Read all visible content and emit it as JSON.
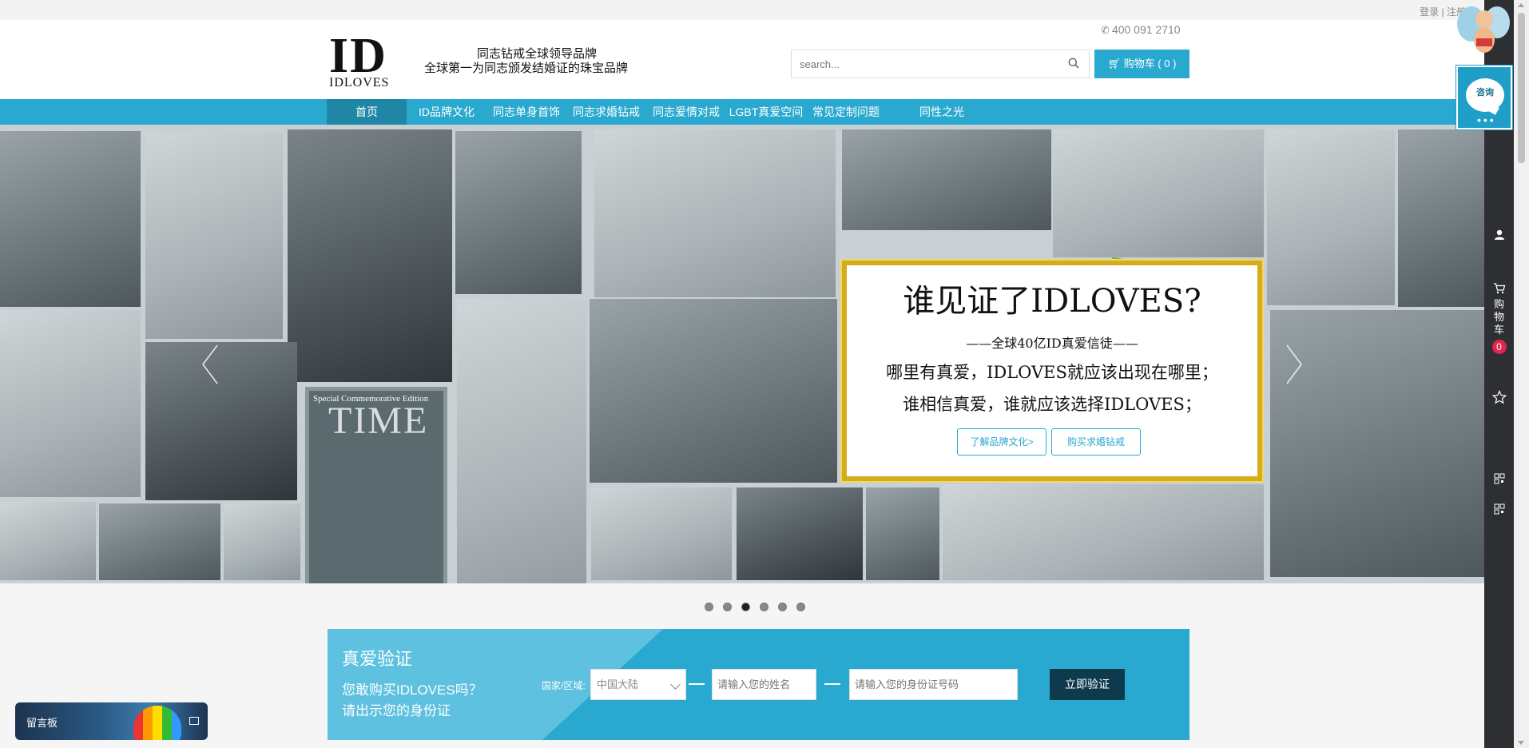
{
  "topbar": {
    "login": "登录",
    "separator": "|",
    "register": "注册"
  },
  "header": {
    "logo_mark": "ID",
    "logo_word": "IDLOVES",
    "slogan_line1": "同志钻戒全球领导品牌",
    "slogan_line2": "全球第一为同志颁发结婚证的珠宝品牌",
    "phone": "400 091 2710",
    "search_placeholder": "search...",
    "cart_label": "购物车 ( 0 )"
  },
  "nav": {
    "items": [
      {
        "label": "首页",
        "active": true
      },
      {
        "label": "ID品牌文化"
      },
      {
        "label": "同志单身首饰"
      },
      {
        "label": "同志求婚钻戒"
      },
      {
        "label": "同志爱情对戒"
      },
      {
        "label": "LGBT真爱空间"
      },
      {
        "label": "常见定制问题"
      },
      {
        "label": "同性之光"
      }
    ]
  },
  "banner": {
    "time_cover_label": "Special Commemorative Edition",
    "time_cover_title": "TIME",
    "title": "谁见证了IDLOVES?",
    "subtitle": "——全球40亿ID真爱信徒——",
    "line1": "哪里有真爱，IDLOVES就应该出现在哪里；",
    "line2": "谁相信真爱，谁就应该选择IDLOVES；",
    "btn_culture": "了解品牌文化>",
    "btn_buy": "购买求婚钻戒",
    "slides": 6,
    "active_slide": 3
  },
  "verify": {
    "title": "真爱验证",
    "desc_line1": "您敢购买IDLOVES吗？",
    "desc_line2": "请出示您的身份证",
    "region_label": "国家/区域:",
    "region_value": "中国大陆",
    "name_placeholder": "请输入您的姓名",
    "id_placeholder": "请输入您的身份证号码",
    "submit_label": "立即验证"
  },
  "sidebar": {
    "cart_chars": [
      "购",
      "物",
      "车"
    ],
    "cart_count": "0"
  },
  "consult": {
    "label": "咨询"
  },
  "message_board": {
    "label": "留言板"
  },
  "colors": {
    "accent": "#2aa9d0",
    "nav_active": "#1f86a6",
    "sidebar": "#2d2f33",
    "badge": "#e0264f",
    "verify_btn": "#0e3a4d"
  }
}
